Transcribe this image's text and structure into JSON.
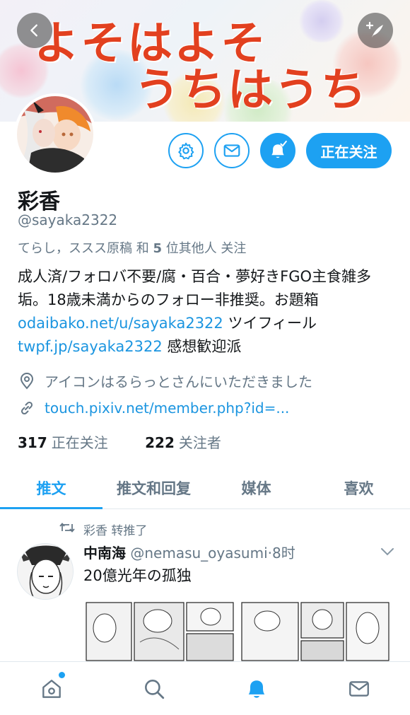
{
  "banner": {
    "title_line1": "よそはよそ",
    "title_line2": "うちはうち",
    "title_color": "#e2401f"
  },
  "header": {
    "back_icon": "chevron-left-icon",
    "compose_icon": "compose-quill-icon"
  },
  "profile": {
    "display_name": "彩香",
    "handle": "@sayaka2322",
    "followed_by_names": "てらし，ススス原稿",
    "followed_by_mid": " 和 ",
    "followed_by_count": "5",
    "followed_by_tail": " 位其他人 关注",
    "bio_line1": "成人済/フォロバ不要/腐・百合・夢好きFGO主食雑多垢。18歳未満からのフォロー非推奨。お題箱",
    "bio_link1": "odaibako.net/u/sayaka2322",
    "bio_after_link1": " ツイフィール",
    "bio_link2": "twpf.jp/sayaka2322",
    "bio_after_link2": " 感想歓迎派",
    "location": "アイコンはるらっとさんにいただきました",
    "website": "touch.pixiv.net/member.php?id=...",
    "following_count": "317",
    "following_label": "正在关注",
    "followers_count": "222",
    "followers_label": "关注者"
  },
  "actions": {
    "settings_icon": "gear-icon",
    "message_icon": "envelope-icon",
    "notify_icon": "bell-check-icon",
    "follow_label": "正在关注"
  },
  "tabs": [
    {
      "label": "推文",
      "active": true
    },
    {
      "label": "推文和回复",
      "active": false
    },
    {
      "label": "媒体",
      "active": false
    },
    {
      "label": "喜欢",
      "active": false
    }
  ],
  "tweet": {
    "retweeted_by": "彩香 转推了",
    "author_name": "中南海",
    "author_handle": "@nemasu_oyasumi",
    "time": "·8时",
    "text": "20億光年の孤独"
  },
  "bottom_nav": [
    {
      "name": "home",
      "icon": "home-icon",
      "active": false
    },
    {
      "name": "search",
      "icon": "search-icon",
      "active": false
    },
    {
      "name": "notifications",
      "icon": "bell-icon",
      "active": true
    },
    {
      "name": "messages",
      "icon": "envelope-icon",
      "active": false
    }
  ],
  "colors": {
    "accent": "#1da1f2",
    "link": "#1b95e0",
    "secondary_text": "#657786"
  }
}
